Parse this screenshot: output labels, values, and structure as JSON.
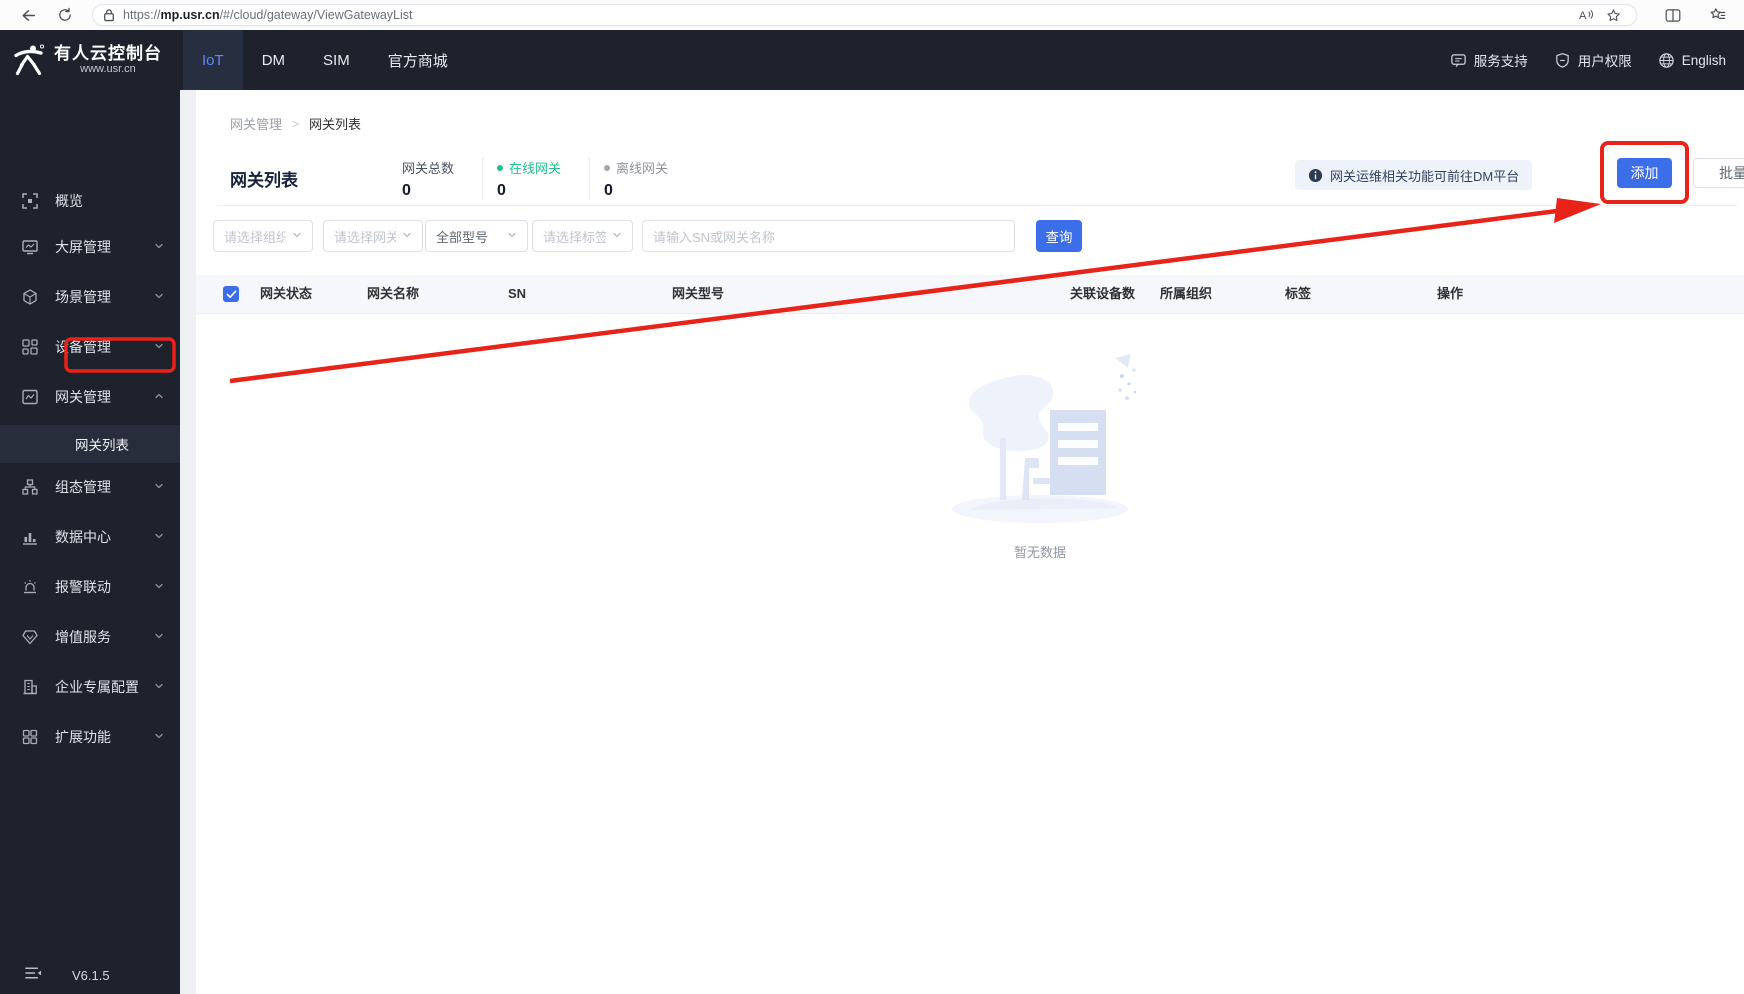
{
  "browser": {
    "url_protocol": "https://",
    "url_host": "mp.usr.cn",
    "url_path": "/#/cloud/gateway/ViewGatewayList"
  },
  "header": {
    "logo_title": "有人云控制台",
    "logo_subtitle": "www.usr.cn",
    "nav": [
      {
        "label": "IoT",
        "active": true
      },
      {
        "label": "DM",
        "active": false
      },
      {
        "label": "SIM",
        "active": false
      },
      {
        "label": "官方商城",
        "active": false
      }
    ],
    "right": [
      {
        "label": "服务支持",
        "icon": "chat-icon"
      },
      {
        "label": "用户权限",
        "icon": "shield-icon"
      },
      {
        "label": "English",
        "icon": "globe-icon"
      }
    ]
  },
  "sidebar": {
    "items": [
      {
        "label": "概览",
        "icon": "overview-icon",
        "expandable": false
      },
      {
        "label": "大屏管理",
        "icon": "screen-icon",
        "expandable": true
      },
      {
        "label": "场景管理",
        "icon": "scene-icon",
        "expandable": true
      },
      {
        "label": "设备管理",
        "icon": "device-icon",
        "expandable": true
      },
      {
        "label": "网关管理",
        "icon": "gateway-icon",
        "expandable": true,
        "expanded": true,
        "children": [
          {
            "label": "网关列表",
            "active": true
          }
        ]
      },
      {
        "label": "组态管理",
        "icon": "config-icon",
        "expandable": true
      },
      {
        "label": "数据中心",
        "icon": "data-icon",
        "expandable": true
      },
      {
        "label": "报警联动",
        "icon": "alarm-icon",
        "expandable": true
      },
      {
        "label": "增值服务",
        "icon": "vas-icon",
        "expandable": true
      },
      {
        "label": "企业专属配置",
        "icon": "enterprise-icon",
        "expandable": true
      },
      {
        "label": "扩展功能",
        "icon": "extension-icon",
        "expandable": true
      }
    ],
    "version": "V6.1.5"
  },
  "breadcrumb": [
    "网关管理",
    "网关列表"
  ],
  "page": {
    "title": "网关列表",
    "stats": [
      {
        "label": "网关总数",
        "value": "0",
        "label_color": "#4a5160",
        "dot": ""
      },
      {
        "label": "在线网关",
        "value": "0",
        "label_color": "#1fc187",
        "dot": "#1fc187"
      },
      {
        "label": "离线网关",
        "value": "0",
        "label_color": "#909399",
        "dot": "#a3a7ad"
      }
    ],
    "notice": "网关运维相关功能可前往DM平台",
    "add_button": "添加",
    "batch_add_button": "批量添加",
    "filters": [
      {
        "type": "select",
        "placeholder": "请选择组织",
        "value": ""
      },
      {
        "type": "select",
        "placeholder": "请选择网关状态",
        "value": ""
      },
      {
        "type": "select",
        "placeholder": "",
        "value": "全部型号"
      },
      {
        "type": "select",
        "placeholder": "请选择标签",
        "value": ""
      },
      {
        "type": "input",
        "placeholder": "请输入SN或网关名称",
        "value": ""
      }
    ],
    "search_button": "查询",
    "table_headers": [
      "网关状态",
      "网关名称",
      "SN",
      "网关型号",
      "关联设备数",
      "所属组织",
      "标签",
      "操作"
    ],
    "empty_text": "暂无数据"
  },
  "colors": {
    "accent_blue": "#3d6eea",
    "online_green": "#1fc187",
    "offline_gray": "#909399",
    "annotation_red": "#e8231a",
    "dark_shell": "#1e222d"
  }
}
